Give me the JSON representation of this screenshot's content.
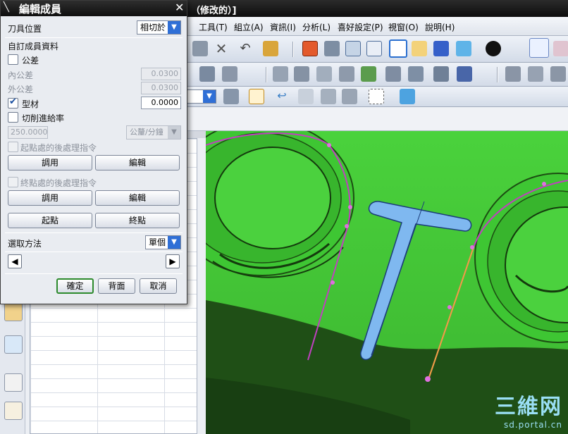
{
  "window": {
    "title": "（修改的）]"
  },
  "menu": [
    "工具(T)",
    "組立(A)",
    "資訊(I)",
    "分析(L)",
    "喜好設定(P)",
    "視窗(O)",
    "說明(H)"
  ],
  "dialog": {
    "title": "編輯成員",
    "tool_position_label": "刀具位置",
    "tool_position_value": "相切於",
    "custom_member_data_label": "自訂成員資料",
    "tolerance_label": "公差",
    "inner_tolerance_label": "內公差",
    "inner_tolerance_value": "0.0300",
    "outer_tolerance_label": "外公差",
    "outer_tolerance_value": "0.0300",
    "stock_label": "型材",
    "stock_value": "0.0000",
    "cut_feed_label": "切削進給率",
    "cut_feed_value": "250.0000",
    "feed_unit_value": "公釐/分鐘",
    "start_postprocess_label": "起點處的後處理指令",
    "end_postprocess_label": "終點處的後處理指令",
    "call_label": "調用",
    "edit_label": "編輯",
    "start_point_label": "起點",
    "end_point_label": "終點",
    "selection_method_label": "選取方法",
    "selection_method_value": "單個",
    "ok_label": "確定",
    "back_label": "背面",
    "cancel_label": "取消"
  },
  "watermark": {
    "big": "三維网",
    "small": "sd.portal.cn"
  },
  "colors": {
    "model_green": "#45d63a",
    "slot_blue": "#7fb8f0",
    "path_magenta": "#c040c0",
    "path_orange": "#f0a040"
  }
}
